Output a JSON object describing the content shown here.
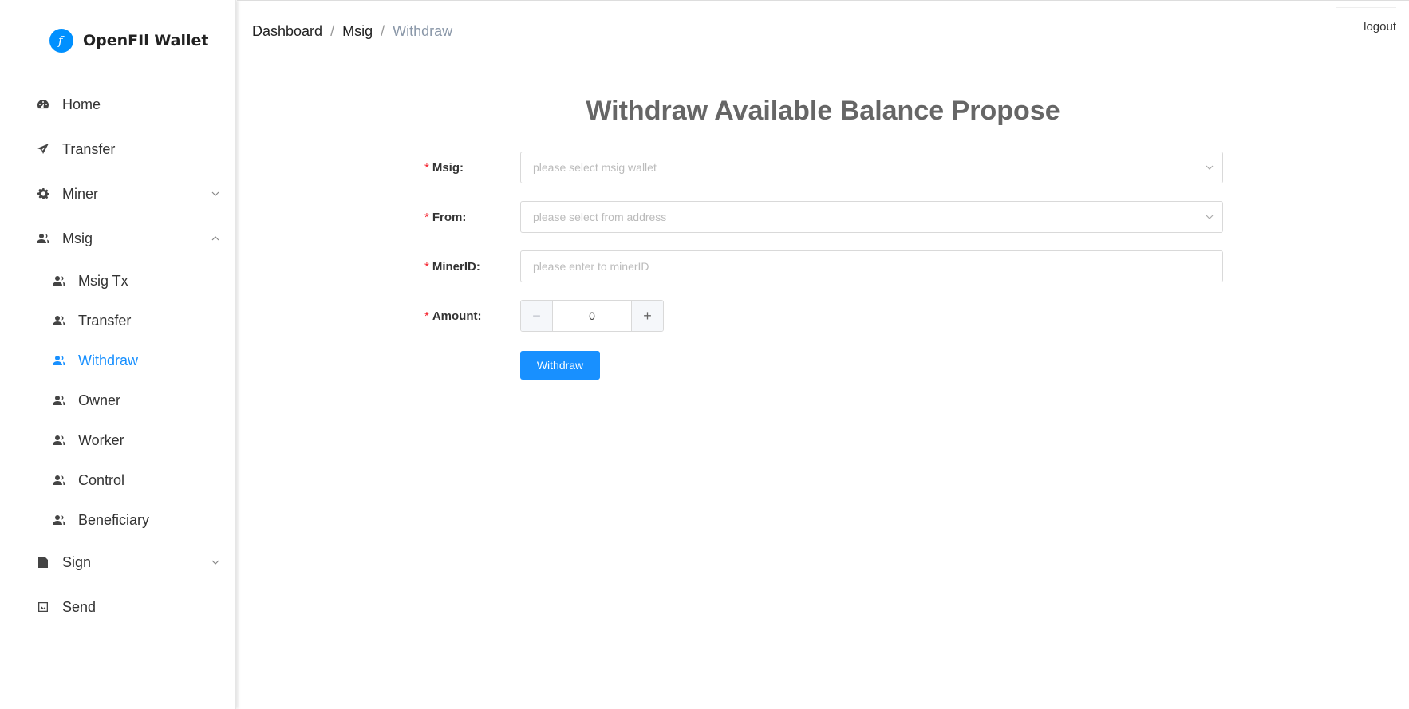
{
  "app": {
    "name": "OpenFIl Wallet",
    "logo_glyph": "f"
  },
  "colors": {
    "accent": "#1890ff",
    "required": "#f5222d"
  },
  "sidebar": {
    "items": [
      {
        "label": "Home",
        "icon": "dashboard-icon"
      },
      {
        "label": "Transfer",
        "icon": "send-icon"
      },
      {
        "label": "Miner",
        "icon": "gear-icon",
        "chevron": "down"
      },
      {
        "label": "Msig",
        "icon": "users-icon",
        "chevron": "up"
      },
      {
        "label": "Sign",
        "icon": "document-icon",
        "chevron": "down"
      },
      {
        "label": "Send",
        "icon": "image-icon"
      }
    ],
    "msig_sub": [
      {
        "label": "Msig Tx"
      },
      {
        "label": "Transfer"
      },
      {
        "label": "Withdraw",
        "active": true
      },
      {
        "label": "Owner"
      },
      {
        "label": "Worker"
      },
      {
        "label": "Control"
      },
      {
        "label": "Beneficiary"
      }
    ]
  },
  "header": {
    "breadcrumb": [
      "Dashboard",
      "Msig",
      "Withdraw"
    ],
    "separator": "/",
    "logout": "logout"
  },
  "form": {
    "title": "Withdraw Available Balance Propose",
    "required_mark": "*",
    "msig": {
      "label": "Msig:",
      "placeholder": "please select msig wallet"
    },
    "from": {
      "label": "From:",
      "placeholder": "please select from address"
    },
    "minerid": {
      "label": "MinerID:",
      "placeholder": "please enter to minerID"
    },
    "amount": {
      "label": "Amount:",
      "value": "0",
      "minus": "−",
      "plus": "+"
    },
    "submit": "Withdraw"
  }
}
